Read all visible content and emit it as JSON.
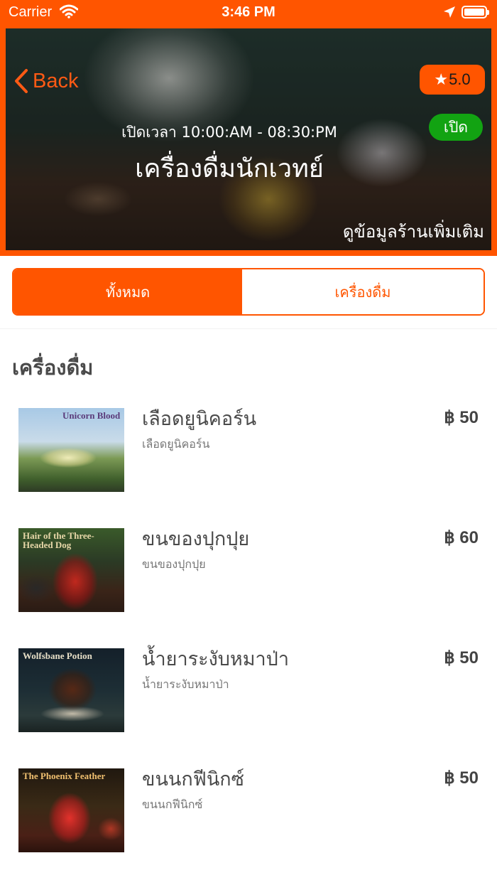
{
  "status_bar": {
    "carrier": "Carrier",
    "time": "3:46 PM"
  },
  "header": {
    "back_label": "Back",
    "rating": "5.0",
    "open_status": "เปิด",
    "hours": "เปิดเวลา 10:00:AM - 08:30:PM",
    "shop_name": "เครื่องดื่มนักเวทย์",
    "more_info": "ดูข้อมูลร้านเพิ่มเติม"
  },
  "tabs": [
    {
      "label": "ทั้งหมด",
      "selected": true
    },
    {
      "label": "เครื่องดื่ม",
      "selected": false
    }
  ],
  "section_title": "เครื่องดื่ม",
  "items": [
    {
      "name": "เลือดยูนิคอร์น",
      "desc": "เลือดยูนิคอร์น",
      "price": "฿ 50",
      "image_text": "Unicorn Blood"
    },
    {
      "name": "ขนของปุกปุย",
      "desc": "ขนของปุกปุย",
      "price": "฿ 60",
      "image_text": "Hair of the Three-Headed Dog"
    },
    {
      "name": "น้ำยาระงับหมาป่า",
      "desc": "น้ำยาระงับหมาป่า",
      "price": "฿ 50",
      "image_text": "Wolfsbane Potion"
    },
    {
      "name": "ขนนกฟีนิกซ์",
      "desc": "ขนนกฟีนิกซ์",
      "price": "฿ 50",
      "image_text": "The Phoenix Feather"
    }
  ],
  "colors": {
    "accent": "#ff5500",
    "open_green": "#12a312"
  }
}
